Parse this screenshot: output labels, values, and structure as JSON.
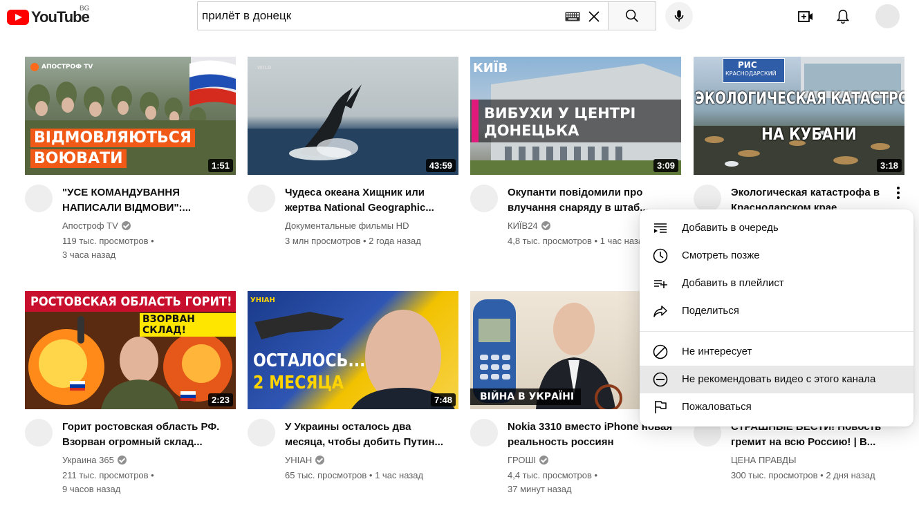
{
  "header": {
    "logo_text": "YouTube",
    "region": "BG",
    "search_value": "прилёт в донецк"
  },
  "videos": [
    {
      "thumb": {
        "line1": "ВІДМОВЛЯЮТЬСЯ",
        "line2": "ВОЮВАТИ",
        "brand": "АПОСТРОФ TV"
      },
      "duration": "1:51",
      "title": "\"УСЕ КОМАНДУВАННЯ НАПИСАЛИ ВІДМОВИ\":...",
      "channel": "Апостроф TV",
      "verified": true,
      "views": "119 тыс. просмотров",
      "age": "3 часа назад"
    },
    {
      "thumb": {
        "brand": "WILD"
      },
      "duration": "43:59",
      "title": "Чудеса океана Хищник или жертва National Geographic...",
      "channel": "Документальные фильмы HD",
      "verified": false,
      "views": "3 млн просмотров",
      "age": "2 года назад"
    },
    {
      "thumb": {
        "brand": "КИЇВ",
        "line1": "ВИБУХИ У ЦЕНТРІ",
        "line2": "ДОНЕЦЬКА"
      },
      "duration": "3:09",
      "title": "Окупанти повідомили про влучання снаряду в штаб...",
      "channel": "КИЇВ24",
      "verified": true,
      "views": "4,8 тыс. просмотров",
      "age": "1 час назад"
    },
    {
      "thumb": {
        "sign1": "РИС",
        "sign2": "КРАСНОДАРСКИЙ",
        "line1": "ЭКОЛОГИЧЕСКАЯ КАТАСТРОФА",
        "line2": "НА КУБАНИ"
      },
      "duration": "3:18",
      "title": "Экологическая катастрофа в Краснодарском крае",
      "channel": "",
      "verified": false,
      "views": "",
      "age": ""
    },
    {
      "thumb": {
        "line1": "РОСТОВСКАЯ ОБЛАСТЬ ГОРИТ!",
        "line2": "ВЗОРВАН СКЛАД!"
      },
      "duration": "2:23",
      "title": "Горит ростовская область РФ. Взорван огромный склад...",
      "channel": "Украина 365",
      "verified": true,
      "views": "211 тыс. просмотров",
      "age": "9 часов назад"
    },
    {
      "thumb": {
        "brand": "УНІАН",
        "line1": "ОСТАЛОСЬ...",
        "line2": "2 МЕСЯЦА"
      },
      "duration": "7:48",
      "title": "У Украины осталось два месяца, чтобы добить Путин...",
      "channel": "УНІАН",
      "verified": true,
      "views": "65 тыс. просмотров",
      "age": "1 час назад"
    },
    {
      "thumb": {
        "line1": "ВІЙНА В УКРАЇНІ"
      },
      "duration": "",
      "title": "Nokia 3310 вместо iPhone новая реальность россиян",
      "channel": "ГРОШІ",
      "verified": true,
      "views": "4,4 тыс. просмотров",
      "age": "37 минут назад"
    },
    {
      "thumb": {},
      "duration": "",
      "title": "СТРАШНЫЕ ВЕСТИ! Новость гремит на всю Россию! | В...",
      "channel": "ЦЕНА ПРАВДЫ",
      "verified": false,
      "views": "300 тыс. просмотров",
      "age": "2 дня назад"
    }
  ],
  "context_menu": {
    "items": [
      {
        "label": "Добавить в очередь",
        "icon": "queue-icon"
      },
      {
        "label": "Смотреть позже",
        "icon": "clock-icon"
      },
      {
        "label": "Добавить в плейлист",
        "icon": "playlist-add-icon"
      },
      {
        "label": "Поделиться",
        "icon": "share-icon"
      },
      {
        "label": "Не интересует",
        "icon": "block-icon"
      },
      {
        "label": "Не рекомендовать видео с этого канала",
        "icon": "minus-circle-icon"
      },
      {
        "label": "Пожаловаться",
        "icon": "flag-icon"
      }
    ]
  }
}
